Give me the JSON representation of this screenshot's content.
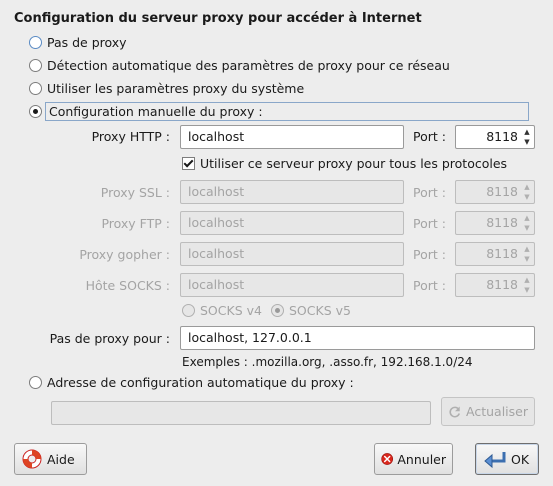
{
  "dialog": {
    "title": "Configuration du serveur proxy pour accéder à Internet"
  },
  "radios": [
    {
      "label": "Pas de proxy"
    },
    {
      "label": "Détection automatique des paramètres de proxy pour ce réseau"
    },
    {
      "label": "Utiliser les paramètres proxy du système"
    },
    {
      "label": "Configuration manuelle du proxy :"
    }
  ],
  "manual": {
    "http": {
      "label": "Proxy HTTP :",
      "value": "localhost",
      "port_label": "Port :",
      "port": "8118"
    },
    "use_for_all": "Utiliser ce serveur proxy pour tous les protocoles",
    "ssl": {
      "label": "Proxy SSL :",
      "value": "localhost",
      "port_label": "Port :",
      "port": "8118"
    },
    "ftp": {
      "label": "Proxy FTP :",
      "value": "localhost",
      "port_label": "Port :",
      "port": "8118"
    },
    "gopher": {
      "label": "Proxy gopher :",
      "value": "localhost",
      "port_label": "Port :",
      "port": "8118"
    },
    "socks": {
      "label": "Hôte SOCKS :",
      "value": "localhost",
      "port_label": "Port :",
      "port": "8118"
    },
    "socks_v4": "SOCKS v4",
    "socks_v5": "SOCKS v5",
    "no_proxy": {
      "label": "Pas de proxy pour :",
      "value": "localhost, 127.0.0.1"
    },
    "examples": "Exemples : .mozilla.org, .asso.fr, 192.168.1.0/24"
  },
  "auto": {
    "label": "Adresse de configuration automatique du proxy :",
    "url": "",
    "reload": "Actualiser"
  },
  "buttons": {
    "help": "Aide",
    "cancel": "Annuler",
    "ok": "OK"
  }
}
